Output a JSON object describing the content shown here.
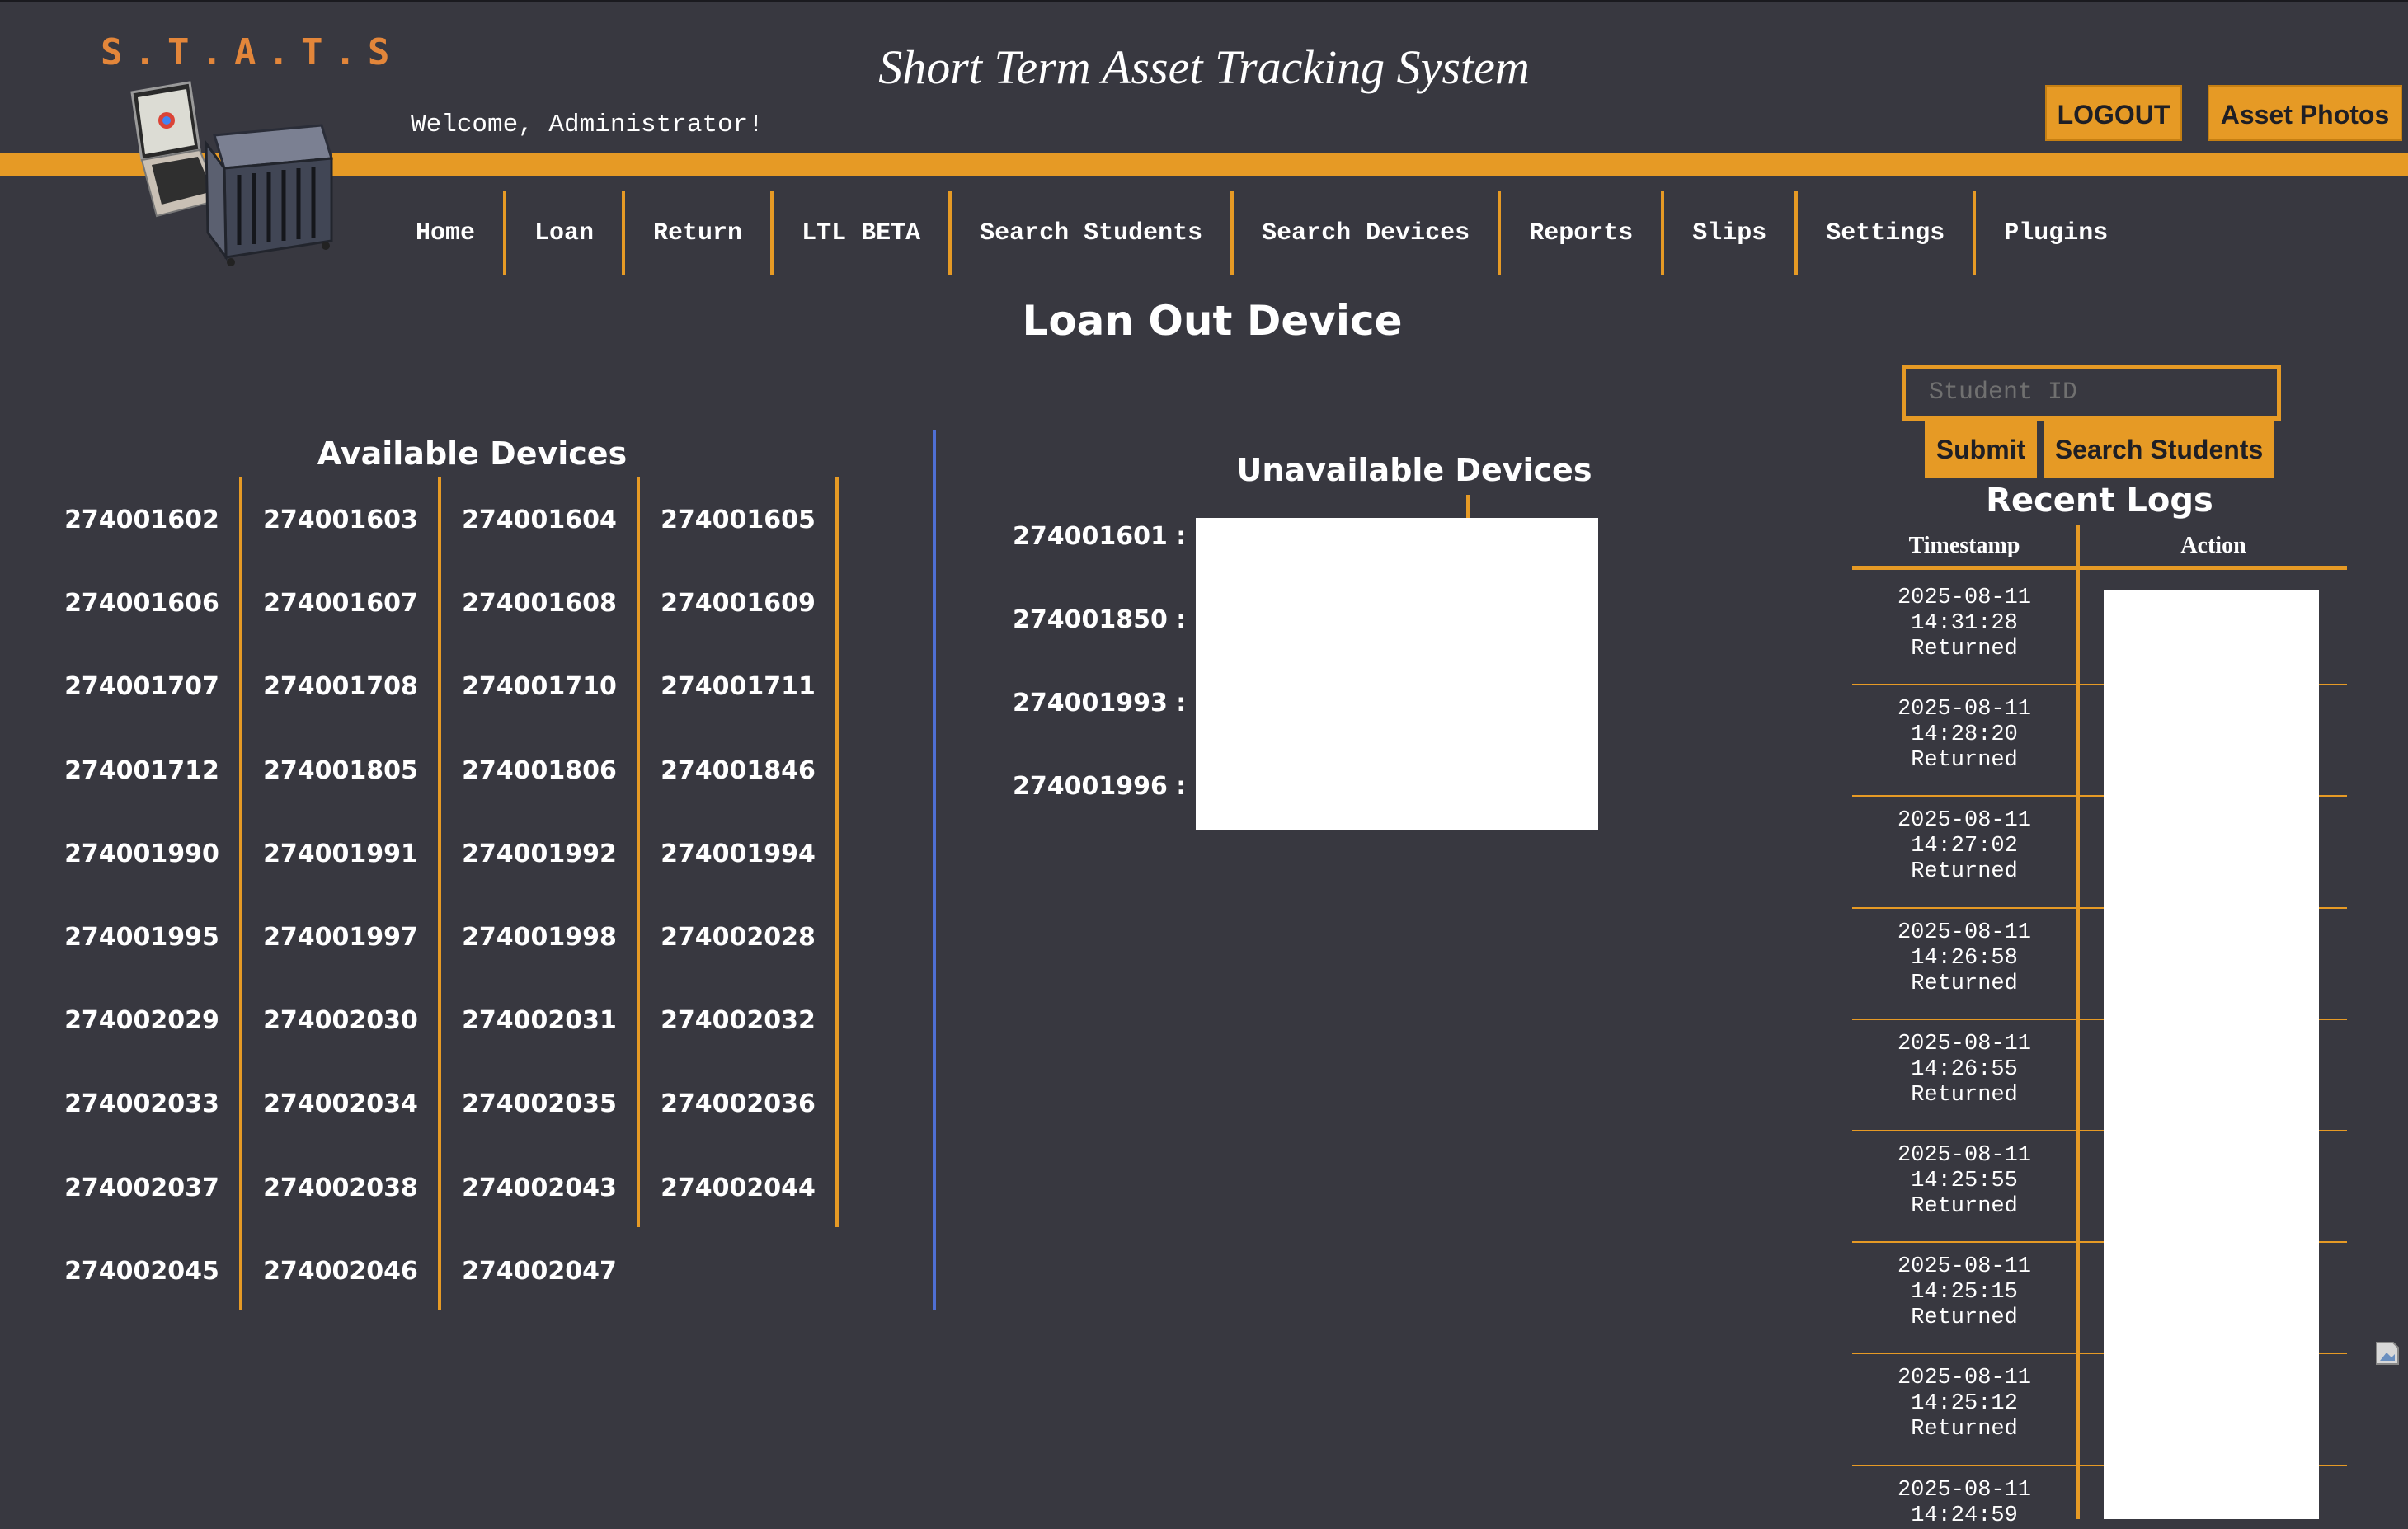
{
  "header": {
    "logo_text": "S.T.A.T.S",
    "title": "Short Term Asset Tracking System",
    "welcome": "Welcome, Administrator!",
    "logout_label": "LOGOUT",
    "asset_photos_label": "Asset Photos"
  },
  "nav": {
    "items": [
      "Home",
      "Loan",
      "Return",
      "LTL BETA",
      "Search Students",
      "Search Devices",
      "Reports",
      "Slips",
      "Settings",
      "Plugins"
    ]
  },
  "page": {
    "title": "Loan Out Device"
  },
  "available": {
    "heading": "Available Devices",
    "devices": [
      "274001602",
      "274001603",
      "274001604",
      "274001605",
      "274001606",
      "274001607",
      "274001608",
      "274001609",
      "274001707",
      "274001708",
      "274001710",
      "274001711",
      "274001712",
      "274001805",
      "274001806",
      "274001846",
      "274001990",
      "274001991",
      "274001992",
      "274001994",
      "274001995",
      "274001997",
      "274001998",
      "274002028",
      "274002029",
      "274002030",
      "274002031",
      "274002032",
      "274002033",
      "274002034",
      "274002035",
      "274002036",
      "274002037",
      "274002038",
      "274002043",
      "274002044",
      "274002045",
      "274002046",
      "274002047"
    ]
  },
  "unavailable": {
    "heading": "Unavailable Devices",
    "devices": [
      "274001601 :",
      "274001850 :",
      "274001993 :",
      "274001996 :"
    ]
  },
  "sidebar": {
    "student_id_placeholder": "Student ID",
    "submit_label": "Submit",
    "search_students_label": "Search Students"
  },
  "logs": {
    "heading": "Recent Logs",
    "col_timestamp": "Timestamp",
    "col_action": "Action",
    "rows": [
      {
        "date": "2025-08-11",
        "time": "14:31:28",
        "status": "Returned"
      },
      {
        "date": "2025-08-11",
        "time": "14:28:20",
        "status": "Returned"
      },
      {
        "date": "2025-08-11",
        "time": "14:27:02",
        "status": "Returned"
      },
      {
        "date": "2025-08-11",
        "time": "14:26:58",
        "status": "Returned"
      },
      {
        "date": "2025-08-11",
        "time": "14:26:55",
        "status": "Returned"
      },
      {
        "date": "2025-08-11",
        "time": "14:25:55",
        "status": "Returned"
      },
      {
        "date": "2025-08-11",
        "time": "14:25:15",
        "status": "Returned"
      },
      {
        "date": "2025-08-11",
        "time": "14:25:12",
        "status": "Returned"
      },
      {
        "date": "2025-08-11",
        "time": "14:24:59",
        "status": ""
      }
    ]
  },
  "colors": {
    "accent": "#e69a25",
    "background": "#383840",
    "divider": "#4f6fd3"
  }
}
